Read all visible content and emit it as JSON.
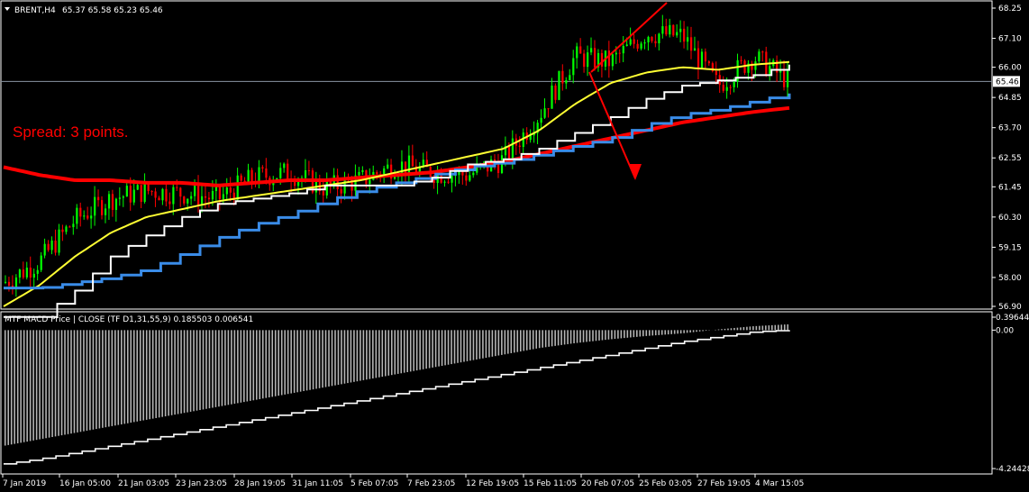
{
  "header": {
    "symbol_tf": "BRENT,H4",
    "ohlc": "65.37 65.58 65.23 65.46"
  },
  "annotation": {
    "spread_text": "Spread: 3 points."
  },
  "colors": {
    "background": "#000000",
    "candle_up": "#00ff00",
    "candle_down": "#ff0000",
    "ma_slow": "#ff0000",
    "ma_fast": "#ffff33",
    "stair_white": "#ffffff",
    "stair_blue": "#3a8ce8",
    "trend_arrow": "#ff0000",
    "macd_hist": "#b4b4b4",
    "macd_signal": "#ffffff",
    "bid_line": "#8a94a3"
  },
  "chart_data": [
    {
      "type": "line",
      "name": "price-panel",
      "yticks": [
        "68.25",
        "67.10",
        "66.00",
        "64.85",
        "63.70",
        "62.55",
        "61.45",
        "60.30",
        "59.15",
        "58.00",
        "56.90"
      ],
      "ylim": [
        56.9,
        68.25
      ],
      "current_price": "65.46",
      "xticks": [
        "7 Jan 2019",
        "16 Jan 05:00",
        "21 Jan 03:05",
        "23 Jan 23:05",
        "28 Jan 19:05",
        "31 Jan 11:05",
        "5 Feb 07:05",
        "7 Feb 23:05",
        "12 Feb 19:05",
        "15 Feb 11:05",
        "20 Feb 07:05",
        "25 Feb 03:05",
        "27 Feb 19:05",
        "4 Mar 15:05"
      ],
      "x": [
        0,
        10,
        20,
        30,
        40,
        50,
        60,
        70,
        80,
        90,
        100,
        110,
        120,
        130,
        140,
        150,
        160,
        170,
        180,
        190,
        200,
        210,
        220
      ],
      "series": [
        {
          "key": "close",
          "values": [
            57.8,
            58.6,
            60.2,
            61.0,
            61.3,
            61.2,
            61.0,
            61.8,
            62.0,
            61.4,
            61.7,
            62.3,
            62.0,
            61.9,
            62.5,
            64.2,
            66.4,
            66.2,
            67.3,
            67.2,
            65.3,
            66.4,
            65.46
          ]
        },
        {
          "key": "ma-slow",
          "values": [
            62.2,
            61.9,
            61.7,
            61.7,
            61.6,
            61.6,
            61.5,
            61.6,
            61.7,
            61.7,
            61.8,
            61.9,
            62.0,
            62.2,
            62.4,
            62.7,
            63.0,
            63.3,
            63.6,
            63.9,
            64.1,
            64.3,
            64.45
          ]
        },
        {
          "key": "ma-fast",
          "values": [
            56.9,
            57.7,
            58.8,
            59.7,
            60.3,
            60.6,
            60.9,
            61.1,
            61.3,
            61.5,
            61.7,
            62.0,
            62.3,
            62.6,
            62.9,
            63.6,
            64.6,
            65.4,
            65.8,
            66.0,
            65.9,
            66.1,
            66.2
          ]
        },
        {
          "key": "stair-white",
          "values": [
            56.5,
            56.5,
            57.5,
            58.8,
            59.6,
            60.3,
            60.8,
            61.0,
            61.2,
            61.5,
            61.5,
            61.5,
            61.8,
            62.3,
            62.5,
            62.9,
            63.5,
            64.1,
            64.8,
            65.3,
            65.5,
            65.7,
            66.1
          ]
        },
        {
          "key": "stair-blue",
          "values": [
            57.6,
            57.6,
            57.8,
            58.0,
            58.3,
            58.9,
            59.5,
            60.0,
            60.4,
            60.9,
            61.3,
            61.6,
            61.9,
            62.2,
            62.4,
            62.7,
            63.0,
            63.3,
            63.8,
            64.2,
            64.4,
            64.7,
            65.0
          ]
        }
      ]
    },
    {
      "type": "bar",
      "name": "macd-panel",
      "title": "MTF MACD Price | CLOSE  (TF D1,31,55,9) 0.185503 0.006541",
      "yticks": [
        "0.396445",
        "0.00",
        "-4.244281"
      ],
      "ylim": [
        -4.244281,
        0.396445
      ],
      "x": [
        0,
        10,
        20,
        30,
        40,
        50,
        60,
        70,
        80,
        90,
        100,
        110,
        120,
        130,
        140,
        150,
        160,
        170,
        180,
        190,
        200,
        210,
        220
      ],
      "series": [
        {
          "key": "histogram",
          "values": [
            -3.55,
            -3.35,
            -3.15,
            -2.95,
            -2.75,
            -2.55,
            -2.35,
            -2.15,
            -1.95,
            -1.75,
            -1.55,
            -1.35,
            -1.15,
            -0.95,
            -0.75,
            -0.55,
            -0.4,
            -0.28,
            -0.18,
            -0.1,
            0.02,
            0.12,
            0.18
          ]
        },
        {
          "key": "signal",
          "values": [
            -4.1,
            -3.95,
            -3.75,
            -3.55,
            -3.35,
            -3.15,
            -2.95,
            -2.75,
            -2.55,
            -2.35,
            -2.15,
            -1.95,
            -1.75,
            -1.55,
            -1.35,
            -1.15,
            -0.95,
            -0.75,
            -0.55,
            -0.35,
            -0.2,
            -0.05,
            0.0
          ]
        }
      ]
    }
  ]
}
